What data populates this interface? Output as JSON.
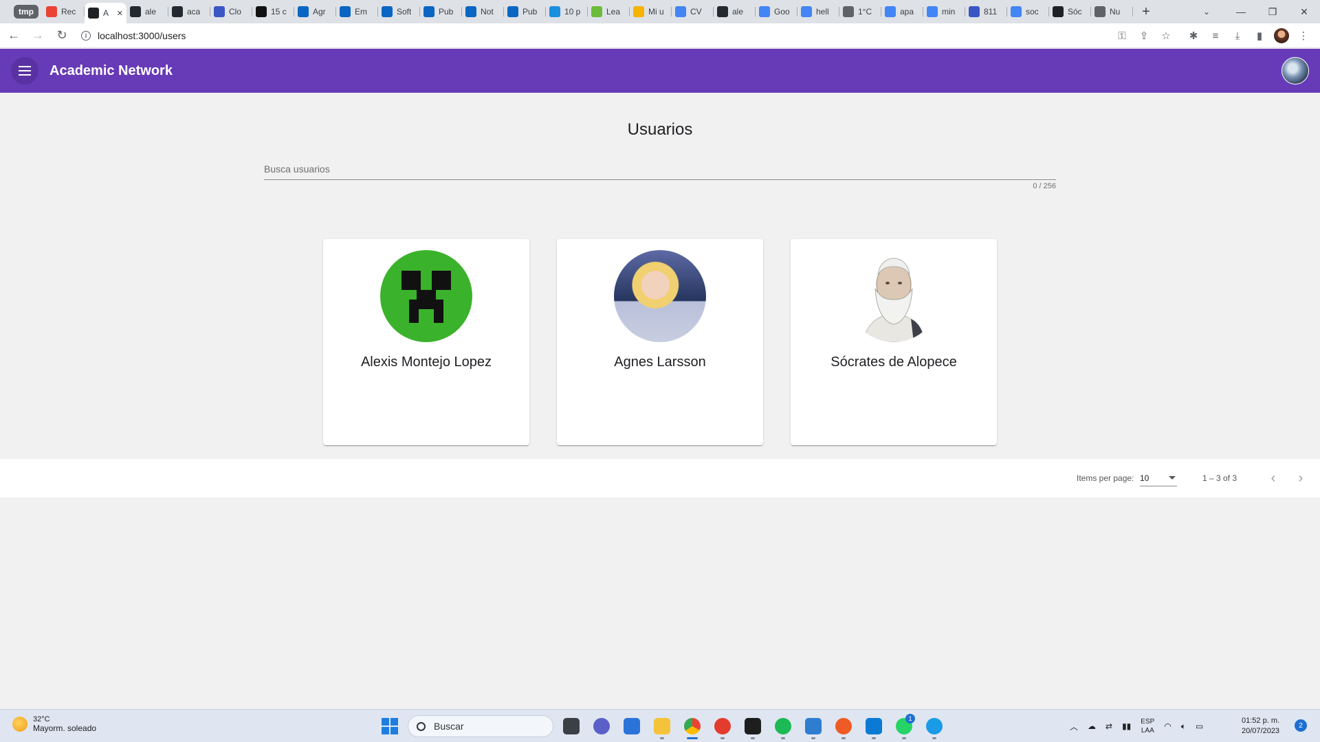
{
  "browser": {
    "tab_group_label": "tmp",
    "tabs": [
      {
        "label": "Rec",
        "icon": "gmail-icon",
        "color": "#ea4335"
      },
      {
        "label": "A",
        "icon": "angular-icon",
        "color": "#202124",
        "active": true
      },
      {
        "label": "ale",
        "icon": "github-icon",
        "color": "#24292f"
      },
      {
        "label": "aca",
        "icon": "github-icon",
        "color": "#24292f"
      },
      {
        "label": "Clo",
        "icon": "mongodb-icon",
        "color": "#3a56c5"
      },
      {
        "label": "15 c",
        "icon": "number-icon",
        "color": "#111111"
      },
      {
        "label": "Agr",
        "icon": "linkedin-icon",
        "color": "#0a66c2"
      },
      {
        "label": "Em",
        "icon": "linkedin-icon",
        "color": "#0a66c2"
      },
      {
        "label": "Soft",
        "icon": "linkedin-icon",
        "color": "#0a66c2"
      },
      {
        "label": "Pub",
        "icon": "linkedin-icon",
        "color": "#0a66c2"
      },
      {
        "label": "Not",
        "icon": "linkedin-icon",
        "color": "#0a66c2"
      },
      {
        "label": "Pub",
        "icon": "linkedin-icon",
        "color": "#0a66c2"
      },
      {
        "label": "10 p",
        "icon": "cloud-icon",
        "color": "#1a8fe0"
      },
      {
        "label": "Lea",
        "icon": "leaf-icon",
        "color": "#6dbb3a"
      },
      {
        "label": "Mi u",
        "icon": "drive-icon",
        "color": "#f4b400"
      },
      {
        "label": "CV",
        "icon": "docs-icon",
        "color": "#4285f4"
      },
      {
        "label": "ale",
        "icon": "github-icon",
        "color": "#24292f"
      },
      {
        "label": "Goo",
        "icon": "translate-icon",
        "color": "#4285f4"
      },
      {
        "label": "hell",
        "icon": "google-icon",
        "color": "#4285f4"
      },
      {
        "label": "1°C",
        "icon": "globe-icon",
        "color": "#5f6368"
      },
      {
        "label": "apa",
        "icon": "google-icon",
        "color": "#4285f4"
      },
      {
        "label": "min",
        "icon": "google-icon",
        "color": "#4285f4"
      },
      {
        "label": "811",
        "icon": "mongodb-icon",
        "color": "#3a56c5"
      },
      {
        "label": "soc",
        "icon": "google-icon",
        "color": "#4285f4"
      },
      {
        "label": "Sóc",
        "icon": "wikipedia-icon",
        "color": "#202124"
      },
      {
        "label": "Nu",
        "icon": "globe-icon",
        "color": "#5f6368"
      }
    ],
    "url": "localhost:3000/users"
  },
  "app": {
    "title": "Academic Network"
  },
  "main": {
    "page_title": "Usuarios",
    "search_placeholder": "Busca usuarios",
    "search_value": "",
    "counter": "0 / 256",
    "users": [
      {
        "name": "Alexis Montejo Lopez",
        "avatar": "creeper-avatar"
      },
      {
        "name": "Agnes Larsson",
        "avatar": "photo-avatar"
      },
      {
        "name": "Sócrates de Alopece",
        "avatar": "bust-avatar"
      }
    ],
    "paginator": {
      "items_per_page_label": "Items per page:",
      "items_per_page_value": "10",
      "range_label": "1 – 3 of 3"
    }
  },
  "taskbar": {
    "weather_temp": "32°C",
    "weather_desc": "Mayorm. soleado",
    "search_label": "Buscar",
    "lang_top": "ESP",
    "lang_bottom": "LAA",
    "time": "01:52 p. m.",
    "date": "20/07/2023",
    "notifications": "2",
    "whatsapp_badge": "1"
  }
}
